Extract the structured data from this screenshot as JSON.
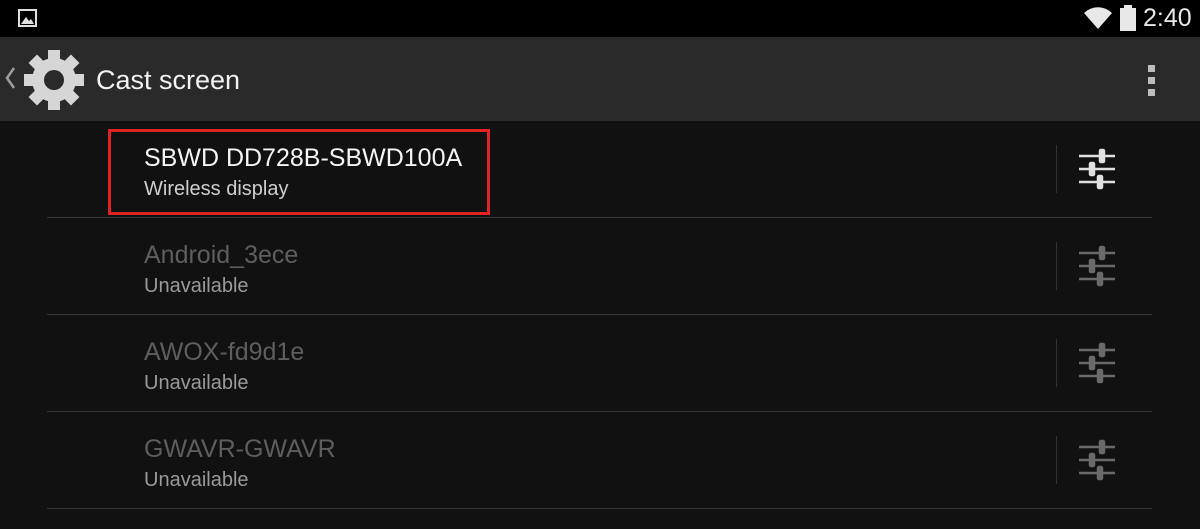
{
  "status_bar": {
    "time": "2:40",
    "icons": [
      "image-notification-icon",
      "wifi-icon",
      "battery-icon"
    ]
  },
  "action_bar": {
    "title": "Cast screen",
    "icons": [
      "up-caret-icon",
      "gear-icon",
      "overflow-menu-icon"
    ]
  },
  "devices": [
    {
      "name": "SBWD DD728B-SBWD100A",
      "status": "Wireless display",
      "available": true
    },
    {
      "name": "Android_3ece",
      "status": "Unavailable",
      "available": false
    },
    {
      "name": "AWOX-fd9d1e",
      "status": "Unavailable",
      "available": false
    },
    {
      "name": "GWAVR-GWAVR",
      "status": "Unavailable",
      "available": false
    }
  ],
  "colors": {
    "highlight_border": "#e02424",
    "action_bar_bg": "#2a2a2a",
    "list_bg": "#111111"
  }
}
